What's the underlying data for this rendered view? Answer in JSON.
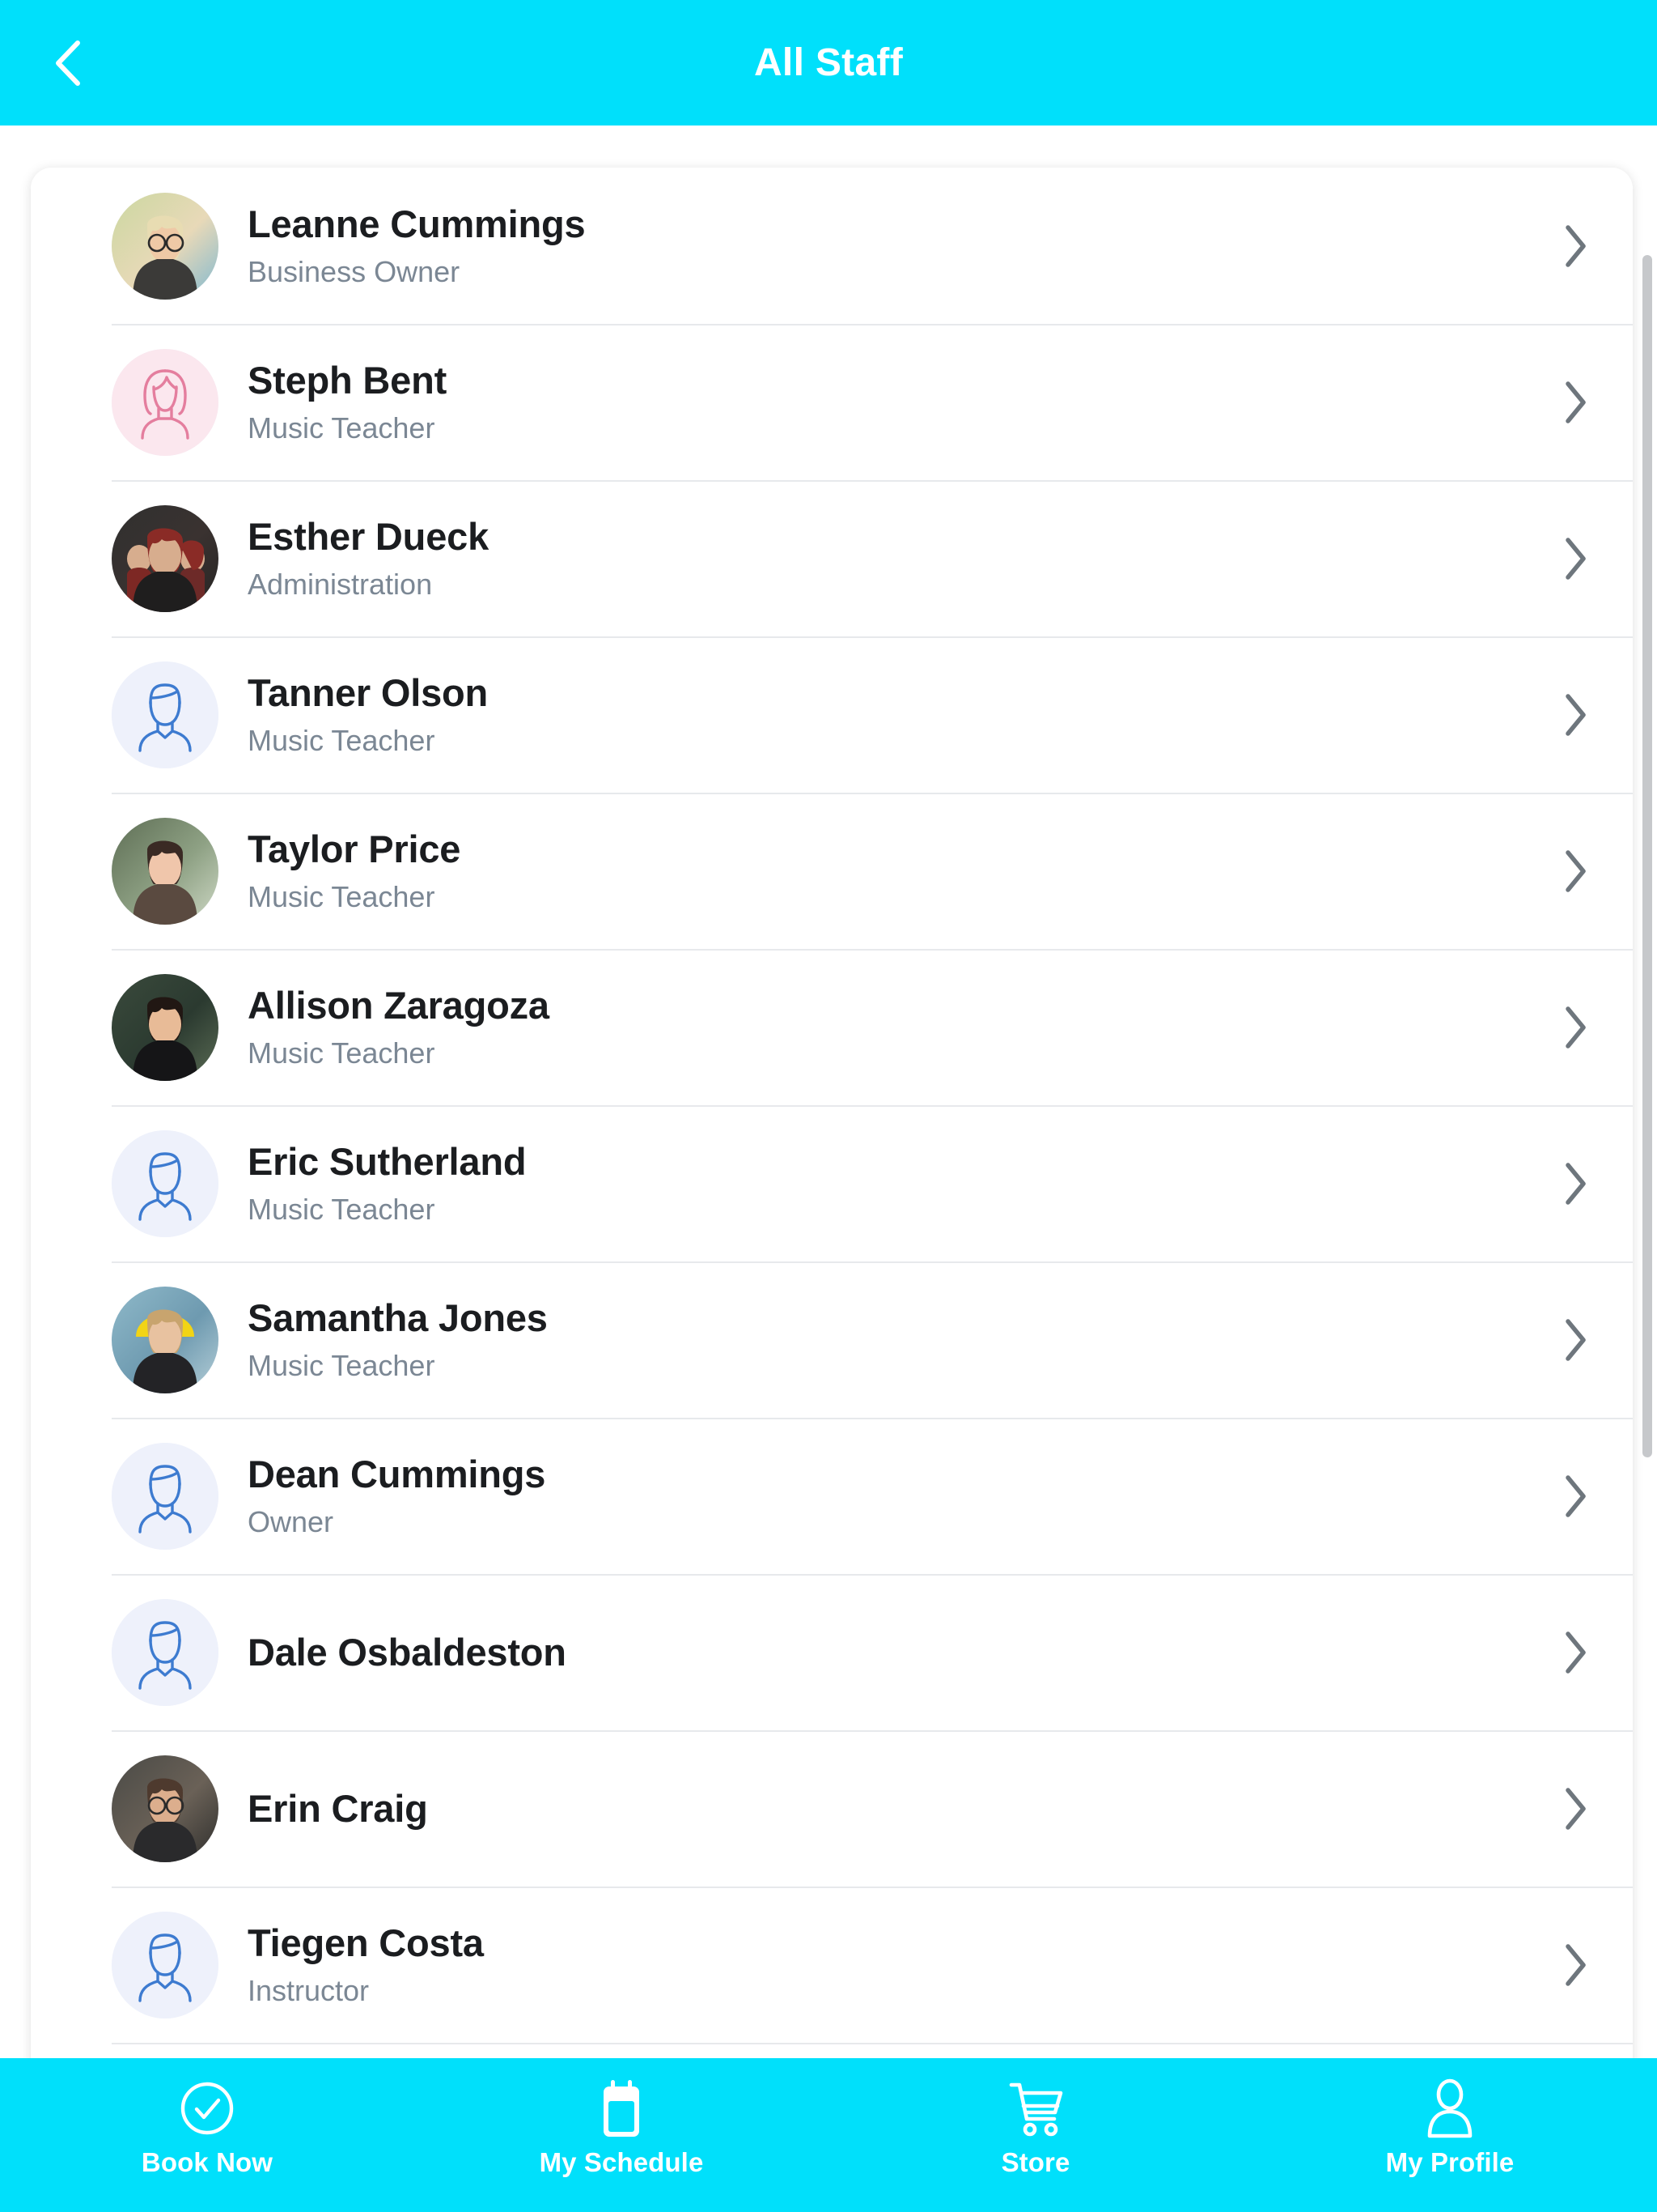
{
  "theme": {
    "accent": "#00E0FB",
    "header_text": "#FFFFFF",
    "name_color": "#1B1D20",
    "role_color": "#7B8794",
    "chevron_color": "#6E767D",
    "divider_color": "#E7E9EC",
    "avatar_blue_bg": "#EEF1FB",
    "avatar_blue_stroke": "#3D7BD0",
    "avatar_pink_bg": "#FBE7EE",
    "avatar_pink_stroke": "#E47E9E",
    "page_bg": "#FFFFFF"
  },
  "header": {
    "title": "All Staff",
    "back_icon": "chevron-left-icon"
  },
  "staff_list": [
    {
      "name": "Leanne Cummings",
      "role": "Business Owner",
      "avatar_type": "photo",
      "photo": "woman-blonde-glasses"
    },
    {
      "name": "Steph Bent",
      "role": "Music Teacher",
      "avatar_type": "placeholder",
      "placeholder": "female-avatar-icon"
    },
    {
      "name": "Esther Dueck",
      "role": "Administration",
      "avatar_type": "photo",
      "photo": "group-dark-photo"
    },
    {
      "name": "Tanner Olson",
      "role": "Music Teacher",
      "avatar_type": "placeholder",
      "placeholder": "male-avatar-icon"
    },
    {
      "name": "Taylor Price",
      "role": "Music Teacher",
      "avatar_type": "photo",
      "photo": "woman-dark-hair-smiling"
    },
    {
      "name": "Allison Zaragoza",
      "role": "Music Teacher",
      "avatar_type": "photo",
      "photo": "woman-long-dark-hair"
    },
    {
      "name": "Eric Sutherland",
      "role": "Music Teacher",
      "avatar_type": "placeholder",
      "placeholder": "male-avatar-icon"
    },
    {
      "name": "Samantha Jones",
      "role": "Music Teacher",
      "avatar_type": "photo",
      "photo": "woman-yellow-umbrella-lake"
    },
    {
      "name": "Dean Cummings",
      "role": "Owner",
      "avatar_type": "placeholder",
      "placeholder": "male-avatar-icon"
    },
    {
      "name": "Dale Osbaldeston",
      "role": "",
      "avatar_type": "placeholder",
      "placeholder": "male-avatar-icon"
    },
    {
      "name": "Erin Craig",
      "role": "",
      "avatar_type": "photo",
      "photo": "woman-glasses-dark"
    },
    {
      "name": "Tiegen Costa",
      "role": "Instructor",
      "avatar_type": "placeholder",
      "placeholder": "male-avatar-icon"
    },
    {
      "name": "",
      "role": "",
      "avatar_type": "placeholder",
      "placeholder": "female-avatar-icon"
    }
  ],
  "bottom_nav": [
    {
      "label": "Book Now",
      "icon": "check-circle-icon"
    },
    {
      "label": "My Schedule",
      "icon": "calendar-icon"
    },
    {
      "label": "Store",
      "icon": "shopping-cart-icon"
    },
    {
      "label": "My Profile",
      "icon": "person-icon"
    }
  ]
}
